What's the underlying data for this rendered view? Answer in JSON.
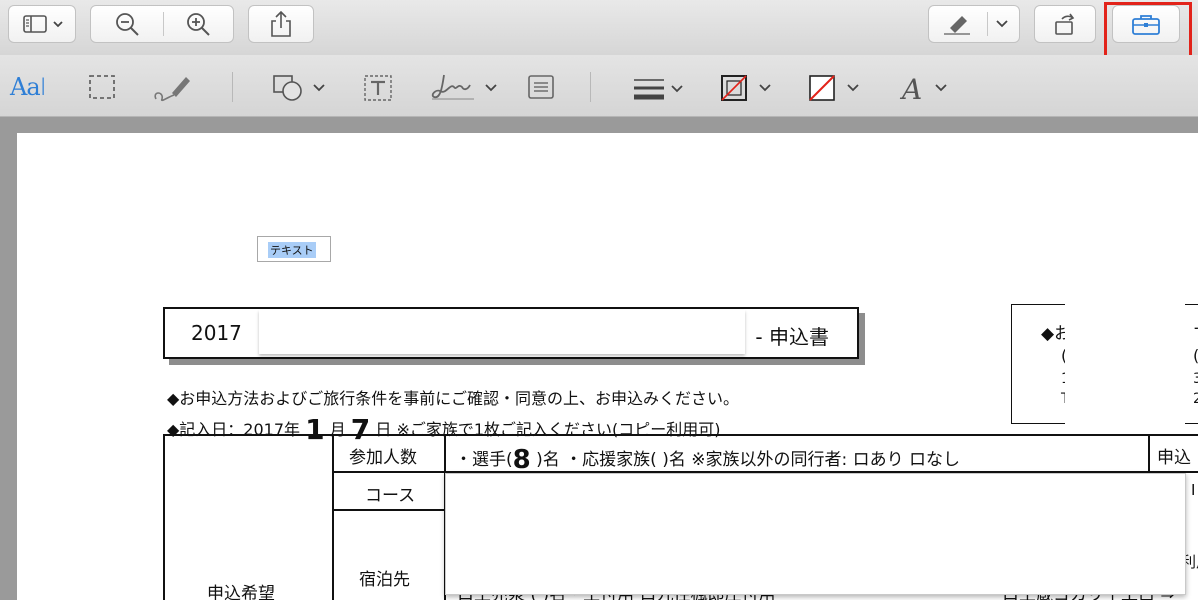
{
  "toolbar": {
    "buttons": [
      {
        "name": "sidebar-view-button",
        "icon": "sidebar-icon"
      },
      {
        "name": "zoom-out-button",
        "icon": "zoom-out-icon"
      },
      {
        "name": "zoom-in-button",
        "icon": "zoom-in-icon"
      },
      {
        "name": "share-button",
        "icon": "share-icon"
      },
      {
        "name": "highlight-button",
        "icon": "highlighter-icon"
      },
      {
        "name": "rotate-button",
        "icon": "rotate-icon"
      },
      {
        "name": "markup-toolbox-button",
        "icon": "toolbox-icon"
      }
    ],
    "accent_color": "#2f7fd6",
    "highlight_color": "#e2231a"
  },
  "markup": {
    "text_selection_label": "Aa",
    "tools": [
      "text-selection",
      "rectangular-selection",
      "sketch",
      "shapes",
      "text-box",
      "sign",
      "note",
      "line-style",
      "border-color",
      "fill-color",
      "text-style"
    ]
  },
  "document": {
    "textbox_label": "テキスト",
    "title_left": "2017 ",
    "title_right": "- 申込書",
    "right_box": {
      "line1": "◆お",
      "line2": "(",
      "line3": "1",
      "line4": "T",
      "right1": "す",
      "right2": "(",
      "right3": "3",
      "right4": "2"
    },
    "note1": "◆お申込方法およびご旅行条件を事前にご確認・同意の上、お申込みください。",
    "note2_prefix": "◆記入日：2017年 ",
    "note2_month": "1",
    "note2_month_label": " 月 ",
    "note2_day": "7",
    "note2_suffix": " 日 ※ご家族で1枚ご記入ください(コピー利用可)",
    "table": {
      "row_header": "申込希望",
      "participants_label": "参加人数",
      "participants_prefix": "・選手(",
      "participants_count": "8",
      "participants_suffix": "  )名 ・応援家族(    )名  ※家族以外の同行者: ロあり ロなし",
      "apply_label": "申込",
      "course_label": "コース",
      "lodging_label": "宿泊先",
      "right_mark1": "I",
      "right_mark2": "利用",
      "bottom_left": "ロ土売泉  (  )名・土付用  ロ九往楓郎庄付用",
      "bottom_right": "ロ土蔵ヨカリ了工白 ⇒"
    }
  }
}
